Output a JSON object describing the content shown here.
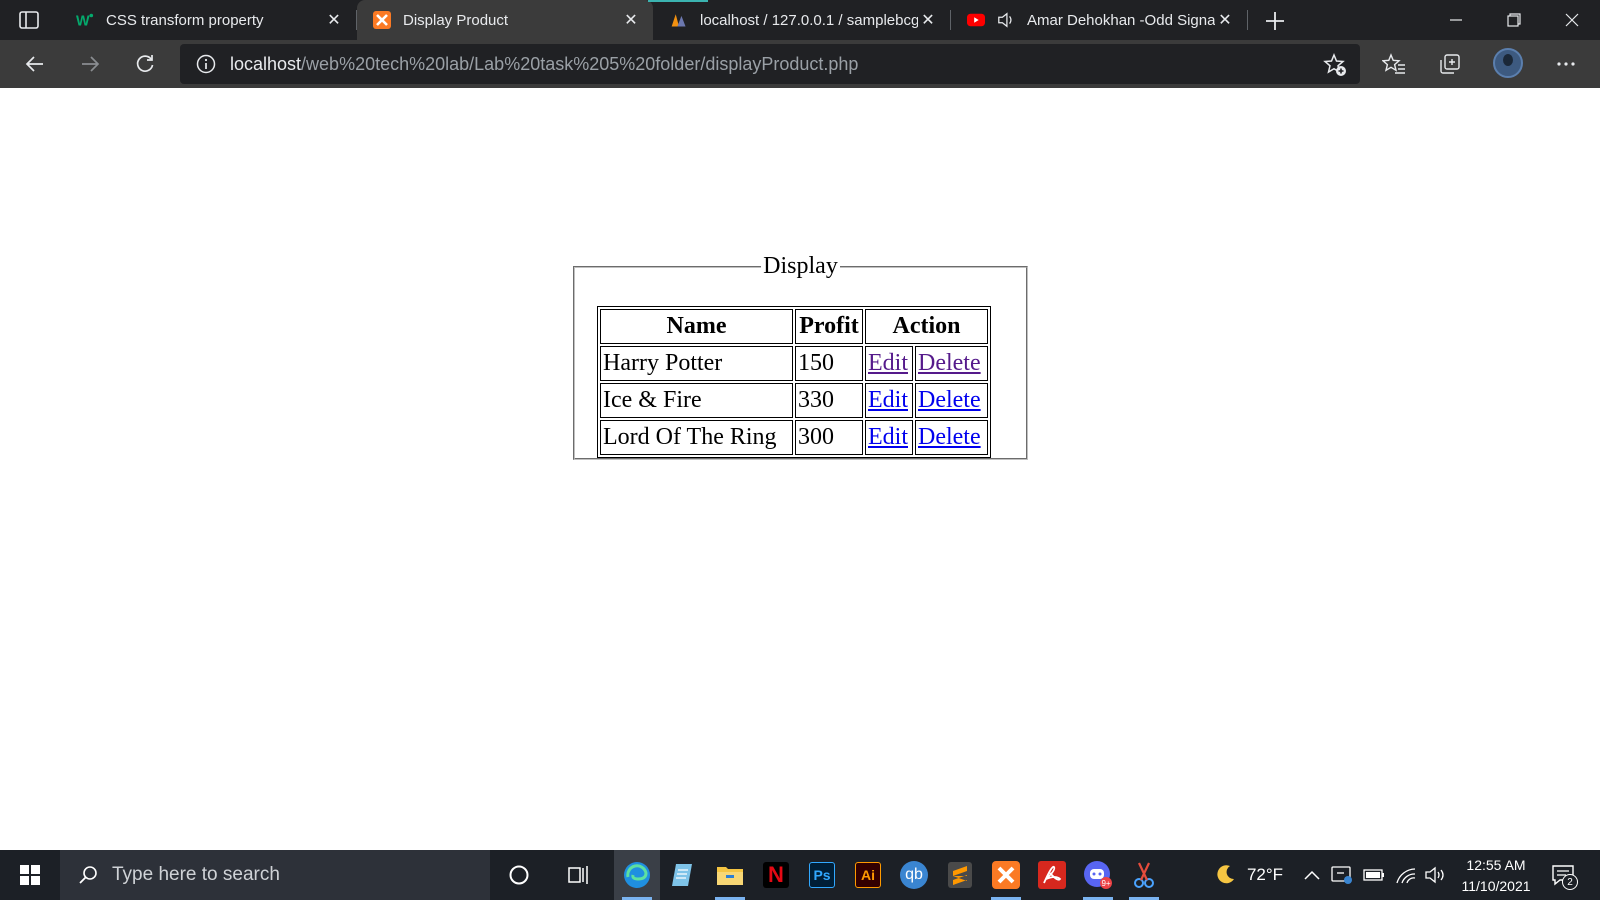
{
  "browser": {
    "tabs": [
      {
        "title": "CSS transform property",
        "icon": "w3schools-icon",
        "active": false
      },
      {
        "title": "Display Product",
        "icon": "xampp-icon",
        "active": true
      },
      {
        "title": "localhost / 127.0.0.1 / samplebcg",
        "icon": "phpmyadmin-icon",
        "active": false
      },
      {
        "title": "Amar Dehokhan -Odd Signature",
        "icon": "youtube-icon",
        "active": false
      }
    ],
    "address": {
      "host": "localhost",
      "path": "/web%20tech%20lab/Lab%20task%205%20folder/displayProduct.php"
    }
  },
  "page": {
    "legend": "Display",
    "table": {
      "headers": [
        "Name",
        "Profit",
        "Action"
      ],
      "rows": [
        {
          "name": "Harry Potter",
          "profit": "150",
          "edit": "Edit",
          "delete": "Delete"
        },
        {
          "name": "Ice & Fire",
          "profit": "330",
          "edit": "Edit",
          "delete": "Delete"
        },
        {
          "name": "Lord Of The Ring",
          "profit": "300",
          "edit": "Edit",
          "delete": "Delete"
        }
      ]
    }
  },
  "taskbar": {
    "search_placeholder": "Type here to search",
    "apps": [
      "cortana-icon",
      "task-view-icon",
      "edge-icon",
      "notepad-icon",
      "file-explorer-icon",
      "netflix-icon",
      "photoshop-icon",
      "illustrator-icon",
      "qbittorrent-icon",
      "sublime-text-icon",
      "xampp-icon",
      "acrobat-icon",
      "discord-icon",
      "snipping-tool-icon"
    ],
    "app_labels": {
      "photoshop": "Ps",
      "illustrator": "Ai",
      "qbittorrent": "qb",
      "netflix": "N",
      "discord_badge": "9+"
    },
    "weather": {
      "temp": "72°F"
    },
    "clock": {
      "time": "12:55 AM",
      "date": "11/10/2021"
    },
    "notifications": "2"
  },
  "colors": {
    "tab_bar": "#202124",
    "toolbar": "#3b3b3b",
    "link": "#0000ee",
    "visited_link": "#551a8b",
    "taskbar": "#1c2026"
  }
}
